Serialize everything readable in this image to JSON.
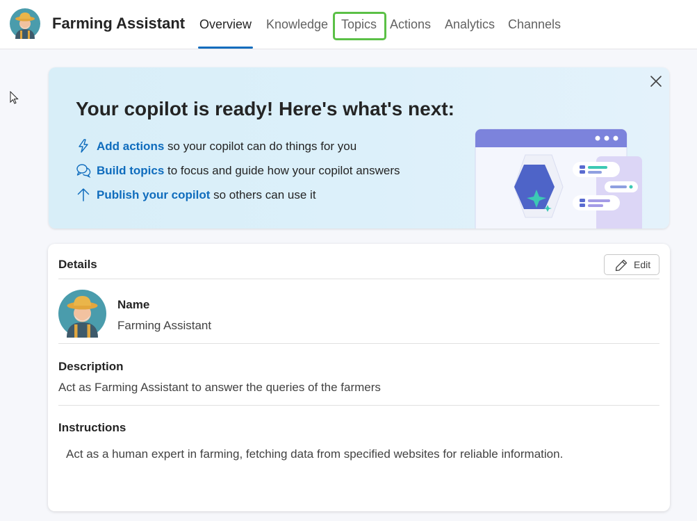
{
  "header": {
    "app_title": "Farming Assistant",
    "tabs": [
      {
        "label": "Overview"
      },
      {
        "label": "Knowledge"
      },
      {
        "label": "Topics"
      },
      {
        "label": "Actions"
      },
      {
        "label": "Analytics"
      },
      {
        "label": "Channels"
      }
    ],
    "active_tab": "Overview",
    "highlighted_tab": "Topics"
  },
  "banner": {
    "title": "Your copilot is ready! Here's what's next:",
    "items": [
      {
        "icon": "lightning-icon",
        "link": "Add actions",
        "text": " so your copilot can do things for you"
      },
      {
        "icon": "chat-bubbles-icon",
        "link": "Build topics",
        "text": " to focus and guide how your copilot answers"
      },
      {
        "icon": "arrow-up-icon",
        "link": "Publish your copilot",
        "text": " so others can use it"
      }
    ]
  },
  "details": {
    "title": "Details",
    "edit_label": "Edit",
    "name_label": "Name",
    "name_value": "Farming Assistant",
    "description_label": "Description",
    "description_value": "Act as Farming Assistant to answer the queries of the farmers",
    "instructions_label": "Instructions",
    "instructions_value": "Act as a human expert in farming, fetching data from specified websites for reliable information."
  },
  "colors": {
    "accent": "#0f6cbd",
    "highlight": "#5bc046",
    "banner_bg": "#d8eef8"
  }
}
